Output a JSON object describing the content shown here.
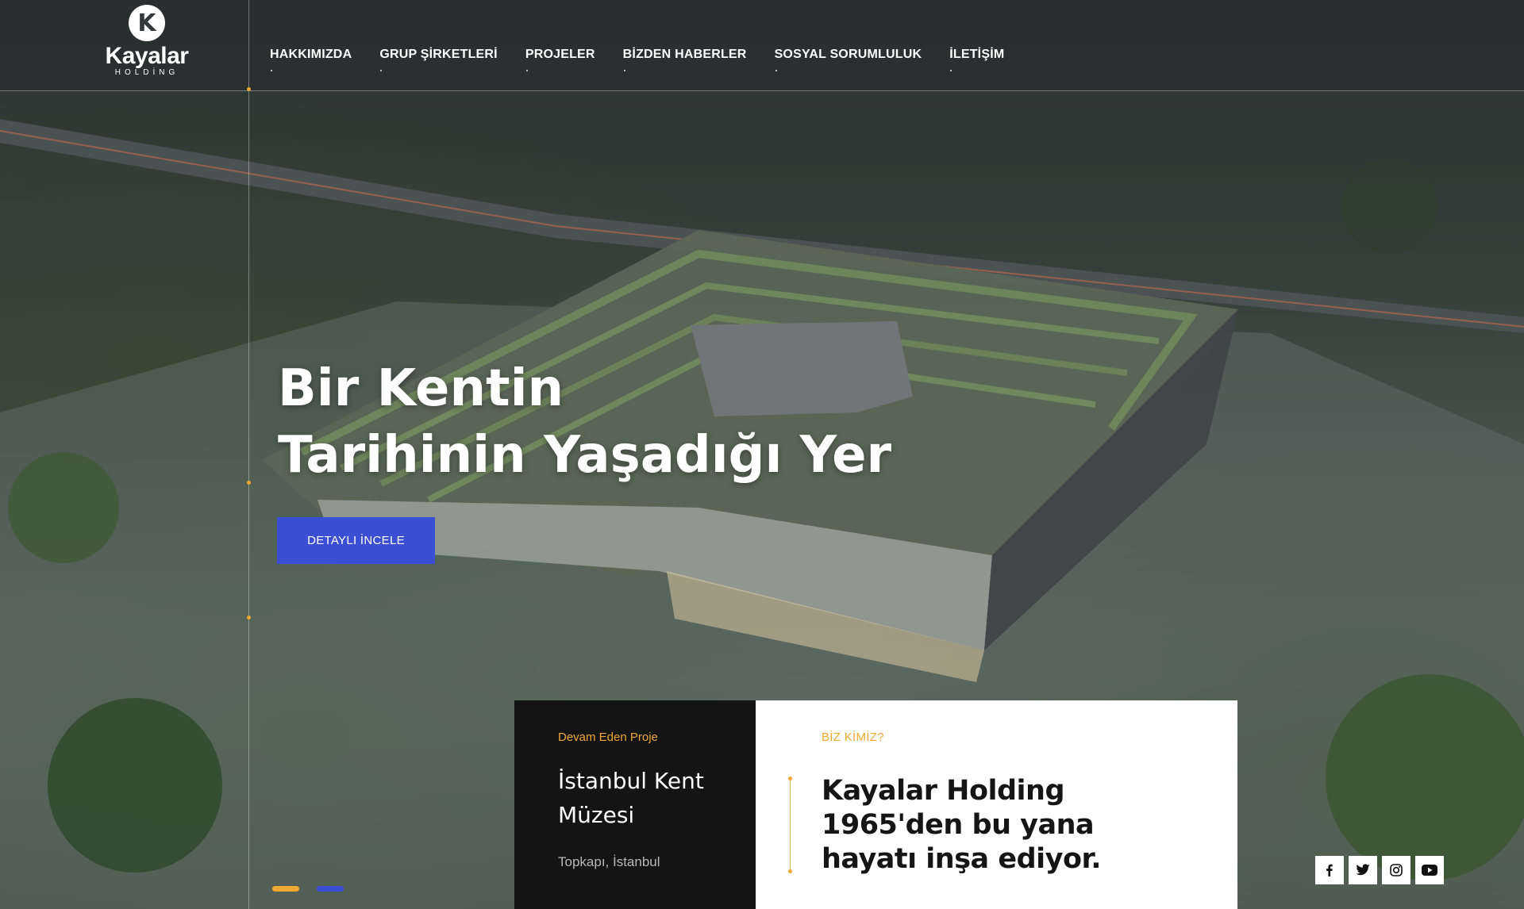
{
  "brand": {
    "logo_letter": "K",
    "name": "Kayalar",
    "subtitle": "HOLDİNG"
  },
  "nav": {
    "items": [
      {
        "label": "HAKKIMIZDA"
      },
      {
        "label": "GRUP ŞİRKETLERİ"
      },
      {
        "label": "PROJELER"
      },
      {
        "label": "BİZDEN HABERLER"
      },
      {
        "label": "SOSYAL SORUMLULUK"
      },
      {
        "label": "İLETİŞİM"
      }
    ]
  },
  "hero": {
    "title_line1": "Bir Kentin",
    "title_line2": "Tarihinin Yaşadığı Yer",
    "cta_label": "DETAYLI İNCELE"
  },
  "project_card": {
    "tag": "Devam Eden Proje",
    "title": "İstanbul Kent Müzesi",
    "location": "Topkapı, İstanbul"
  },
  "about_card": {
    "tag": "BİZ KİMİZ?",
    "title": "Kayalar Holding 1965'den bu yana hayatı inşa ediyor."
  },
  "slider": {
    "dots": [
      {
        "color": "#f0a830"
      },
      {
        "color": "#3a4fd3"
      }
    ]
  },
  "social": {
    "icons": [
      "facebook-icon",
      "twitter-icon",
      "instagram-icon",
      "youtube-icon"
    ]
  },
  "colors": {
    "accent": "#f0a830",
    "primary_button": "#3a4fd3",
    "dark_card": "#141414"
  }
}
